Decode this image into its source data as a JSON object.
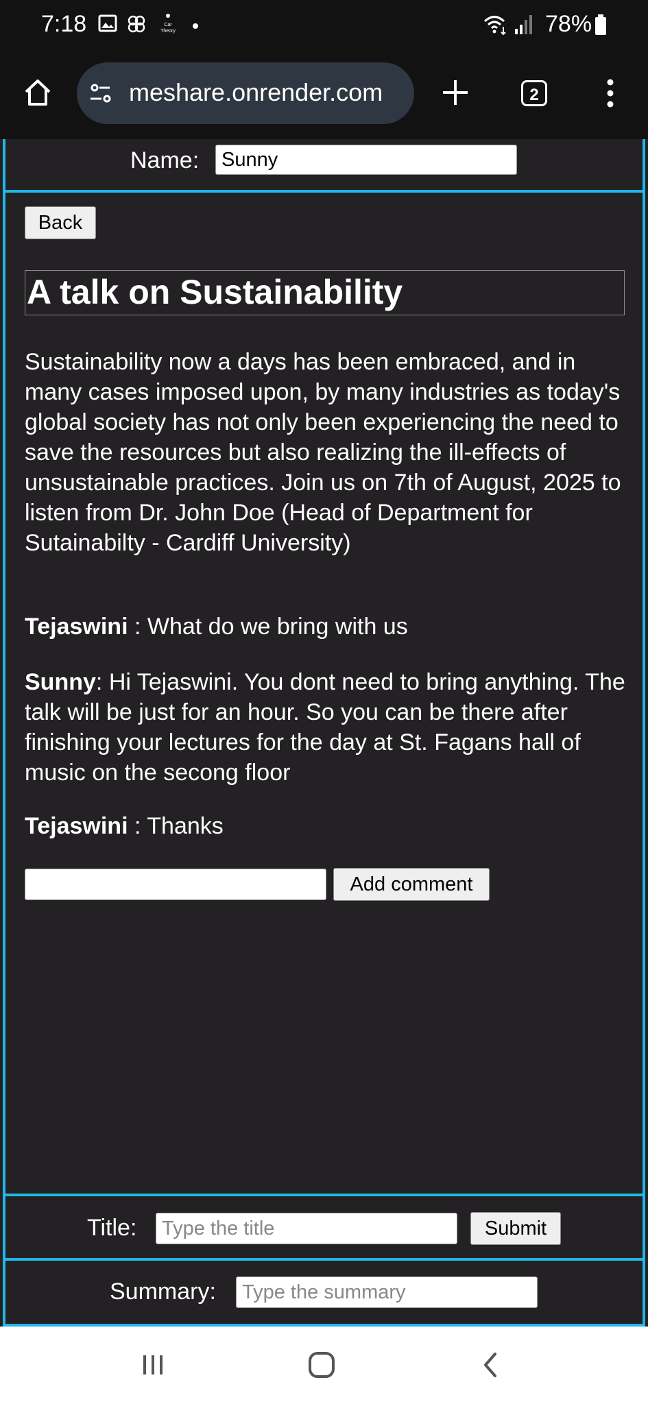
{
  "status_bar": {
    "time": "7:18",
    "battery": "78%",
    "notification_icons": [
      "image-icon",
      "pinwheel-icon",
      "car-theory-icon",
      "dot-icon"
    ],
    "system_icons": [
      "wifi-icon",
      "signal-icon",
      "battery-icon"
    ]
  },
  "browser": {
    "url": "meshare.onrender.com",
    "tab_count": "2"
  },
  "page": {
    "name_label": "Name:",
    "name_value": "Sunny",
    "back_label": "Back",
    "post_title": "A talk on Sustainability",
    "post_description": "Sustainability now a days has been embraced, and in many cases imposed upon, by many industries as today's global society has not only been experiencing the need to save the resources but also realizing the ill-effects of unsustainable practices. Join us on 7th of August, 2025 to listen from Dr. John Doe (Head of Department for Sutainabilty - Cardiff University)",
    "comments": [
      {
        "author": "Tejaswini",
        "separator": " : ",
        "text": "What do we bring with us"
      },
      {
        "author": "Sunny",
        "separator": ": ",
        "text": "Hi Tejaswini. You dont need to bring anything. The talk will be just for an hour. So you can be there after finishing your lectures for the day at St. Fagans hall of music on the secong floor"
      },
      {
        "author": "Tejaswini",
        "separator": " : ",
        "text": "Thanks"
      }
    ],
    "comment_input_value": "",
    "add_comment_label": "Add comment",
    "title_label": "Title:",
    "title_placeholder": "Type the title",
    "submit_label": "Submit",
    "summary_label": "Summary:",
    "summary_placeholder": "Type the summary"
  },
  "colors": {
    "frame_border": "#21b8e8",
    "page_background": "#232123",
    "url_pill": "#2f3742"
  }
}
